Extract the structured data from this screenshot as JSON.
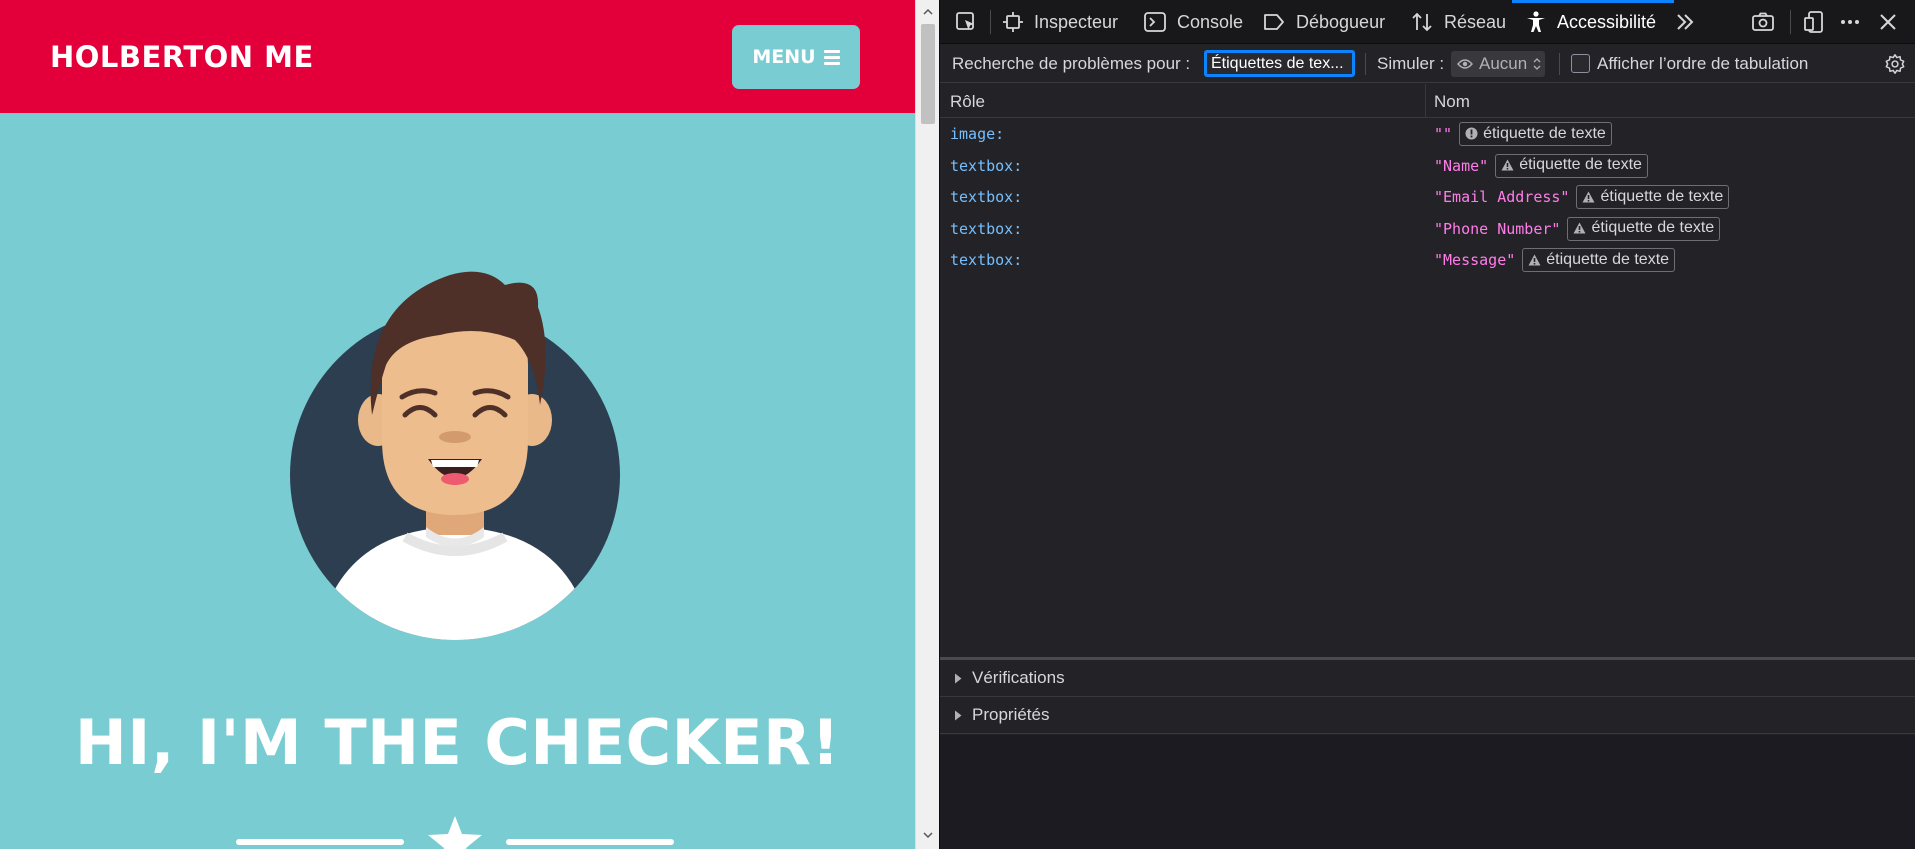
{
  "site": {
    "logo": "HOLBERTON ME",
    "menu_label": "MENU",
    "hero_title": "HI, I'M THE CHECKER!",
    "colors": {
      "header": "#e3003a",
      "background": "#79cdd2",
      "avatar_circle": "#2c3e50"
    }
  },
  "devtools": {
    "tabs": [
      {
        "label": "Inspecteur",
        "icon": "inspector-icon"
      },
      {
        "label": "Console",
        "icon": "console-icon"
      },
      {
        "label": "Débogueur",
        "icon": "debugger-icon"
      },
      {
        "label": "Réseau",
        "icon": "network-icon"
      },
      {
        "label": "Accessibilité",
        "icon": "accessibility-icon",
        "active": true
      }
    ],
    "filter": {
      "label": "Recherche de problèmes pour :",
      "selected": "Étiquettes de tex...",
      "simulate_label": "Simuler :",
      "simulate_value": "Aucun",
      "tab_order_label": "Afficher l’ordre de tabulation",
      "tab_order_checked": false
    },
    "table": {
      "headers": {
        "role": "Rôle",
        "name": "Nom"
      },
      "rows": [
        {
          "role": "image:",
          "name": "\"\"",
          "badge": "étiquette de texte",
          "badge_icon": "info-icon"
        },
        {
          "role": "textbox:",
          "name": "\"Name\"",
          "badge": "étiquette de texte",
          "badge_icon": "warning-icon"
        },
        {
          "role": "textbox:",
          "name": "\"Email Address\"",
          "badge": "étiquette de texte",
          "badge_icon": "warning-icon"
        },
        {
          "role": "textbox:",
          "name": "\"Phone Number\"",
          "badge": "étiquette de texte",
          "badge_icon": "warning-icon"
        },
        {
          "role": "textbox:",
          "name": "\"Message\"",
          "badge": "étiquette de texte",
          "badge_icon": "warning-icon"
        }
      ]
    },
    "sections": {
      "checks": "Vérifications",
      "properties": "Propriétés"
    },
    "colors": {
      "role": "#75bfff",
      "name": "#ff7de9",
      "accent": "#0a84ff"
    }
  }
}
